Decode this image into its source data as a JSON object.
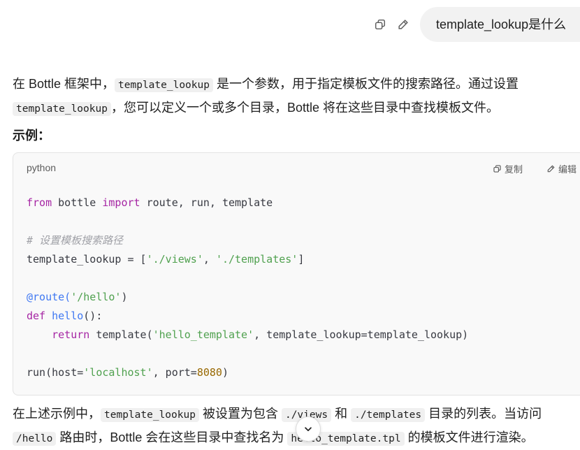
{
  "user_message": {
    "text": "template_lookup是什么"
  },
  "answer": {
    "p1_a": "在 Bottle 框架中，",
    "p1_code1": "template_lookup",
    "p1_b": " 是一个参数，用于指定模板文件的搜索路径。通过设置",
    "p1_code2": "template_lookup",
    "p1_c": "，您可以定义一个或多个目录，Bottle 将在这些目录中查找模板文件。",
    "example_title": "示例：",
    "p2_a": "在上述示例中，",
    "p2_code1": "template_lookup",
    "p2_b": " 被设置为包含 ",
    "p2_code2": "./views",
    "p2_c": " 和 ",
    "p2_code3": "./templates",
    "p2_d": " 目录的列表。当访问",
    "p2_code4": "/hello",
    "p2_e": " 路由时，Bottle 会在这些目录中查找名为 ",
    "p2_code5": "hello_template.tpl",
    "p2_f": " 的模板文件进行渲染。"
  },
  "code_block": {
    "language": "python",
    "copy_label": "复制",
    "edit_label": "编辑",
    "l1_kw_from": "from",
    "l1_mod": " bottle ",
    "l1_kw_import": "import",
    "l1_rest": " route, run, template",
    "l3_comment": "# 设置模板搜索路径",
    "l4_a": "template_lookup = [",
    "l4_s1": "'./views'",
    "l4_b": ", ",
    "l4_s2": "'./templates'",
    "l4_c": "]",
    "l6_deco": "@route(",
    "l6_s": "'/hello'",
    "l6_c": ")",
    "l7_kw": "def",
    "l7_sp": " ",
    "l7_fn": "hello",
    "l7_c": "():",
    "l8_indent": "    ",
    "l8_kw": "return",
    "l8_a": " template(",
    "l8_s": "'hello_template'",
    "l8_b": ", template_lookup=template_lookup)",
    "l10_a": "run(host=",
    "l10_s": "'localhost'",
    "l10_b": ", port=",
    "l10_num": "8080",
    "l10_c": ")"
  },
  "icons": {
    "copy": "copy-icon",
    "edit": "pencil-icon",
    "scroll": "chevron-down-icon"
  }
}
